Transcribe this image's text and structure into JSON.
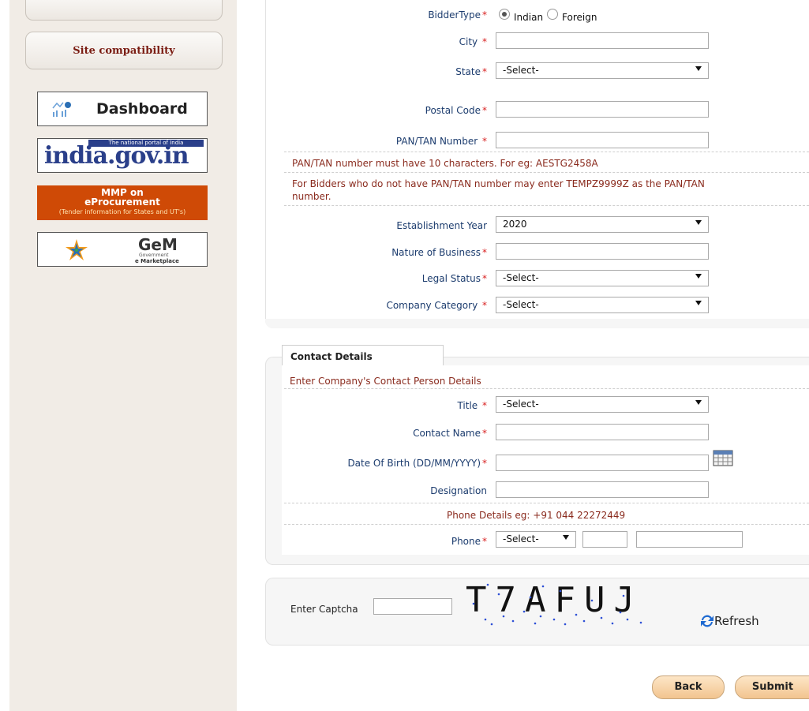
{
  "sidebar": {
    "site_compat": "Site compatibility",
    "dashboard": "Dashboard",
    "india_portal": {
      "tag": "The national portal of India",
      "name": "india.gov.in"
    },
    "mmp": {
      "line1": "MMP on",
      "line2": "eProcurement",
      "line3": "(Tender information for States and UT's)"
    },
    "gem": {
      "name": "GeM",
      "sub1": "Government",
      "sub2": "e Marketplace"
    }
  },
  "form": {
    "bidder_type": {
      "label": "BidderType",
      "option1": "Indian",
      "option2": "Foreign"
    },
    "city": {
      "label": "City"
    },
    "state": {
      "label": "State",
      "value": "-Select-"
    },
    "postal": {
      "label": "Postal Code"
    },
    "pan": {
      "label": "PAN/TAN Number"
    },
    "pan_note1": "PAN/TAN number must have 10 characters. For eg: AESTG2458A",
    "pan_note2a": "For Bidders who do not have PAN/TAN number may enter TEMPZ9999Z as the PAN/TAN",
    "pan_note2b": "number.",
    "est_year": {
      "label": "Establishment Year",
      "value": "2020"
    },
    "nature": {
      "label": "Nature of Business"
    },
    "legal": {
      "label": "Legal Status",
      "value": "-Select-"
    },
    "category": {
      "label": "Company Category",
      "value": "-Select-"
    }
  },
  "contact": {
    "heading": "Contact Details",
    "subheading": "Enter Company's Contact Person Details",
    "title": {
      "label": "Title",
      "value": "-Select-"
    },
    "name": {
      "label": "Contact Name"
    },
    "dob": {
      "label": "Date Of Birth (DD/MM/YYYY)"
    },
    "designation": {
      "label": "Designation"
    },
    "phone_note": "Phone Details eg: +91 044 22272449",
    "phone": {
      "label": "Phone",
      "code": "-Select-"
    }
  },
  "captcha": {
    "label": "Enter Captcha",
    "text": "T7AFUJ",
    "refresh": "Refresh"
  },
  "buttons": {
    "back": "Back",
    "submit": "Submit"
  }
}
